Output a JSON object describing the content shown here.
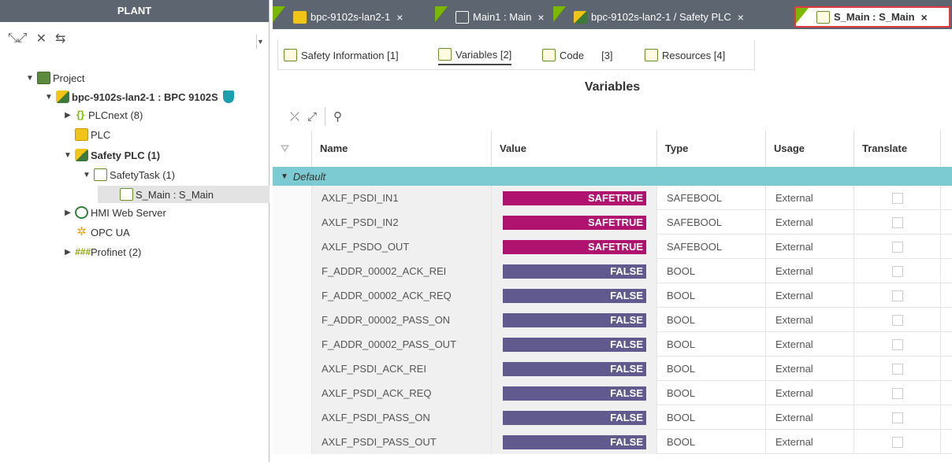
{
  "left_panel": {
    "title": "PLANT",
    "tree": [
      {
        "label": "Project",
        "bold": false
      },
      {
        "label": "bpc-9102s-lan2-1 : BPC 9102S",
        "bold": true
      },
      {
        "label": "PLCnext (8)",
        "bold": false
      },
      {
        "label": "PLC",
        "bold": false
      },
      {
        "label": "Safety PLC (1)",
        "bold": true
      },
      {
        "label": "SafetyTask (1)",
        "bold": false
      },
      {
        "label": "S_Main : S_Main",
        "bold": false
      },
      {
        "label": "HMI Web Server",
        "bold": false
      },
      {
        "label": "OPC UA",
        "bold": false
      },
      {
        "label": "Profinet (2)",
        "bold": false
      }
    ]
  },
  "tabs": [
    {
      "label": "bpc-9102s-lan2-1",
      "close": "×"
    },
    {
      "label": "Main1 : Main",
      "close": "×"
    },
    {
      "label": "bpc-9102s-lan2-1 / Safety PLC",
      "close": "×"
    },
    {
      "label": "S_Main : S_Main",
      "close": "×"
    }
  ],
  "subtabs": [
    {
      "label": "Safety Information [1]"
    },
    {
      "label": "Variables [2]"
    },
    {
      "label": "Code",
      "suffix": "[3]"
    },
    {
      "label": "Resources [4]"
    }
  ],
  "section_title": "Variables",
  "columns": [
    "Name",
    "Value",
    "Type",
    "Usage",
    "Translate"
  ],
  "group": "Default",
  "rows": [
    {
      "name": "AXLF_PSDI_IN1",
      "value": "SAFETRUE",
      "type": "SAFEBOOL",
      "usage": "External",
      "flag": true
    },
    {
      "name": "AXLF_PSDI_IN2",
      "value": "SAFETRUE",
      "type": "SAFEBOOL",
      "usage": "External",
      "flag": true
    },
    {
      "name": "AXLF_PSDO_OUT",
      "value": "SAFETRUE",
      "type": "SAFEBOOL",
      "usage": "External",
      "flag": true
    },
    {
      "name": "F_ADDR_00002_ACK_REI",
      "value": "FALSE",
      "type": "BOOL",
      "usage": "External",
      "flag": false
    },
    {
      "name": "F_ADDR_00002_ACK_REQ",
      "value": "FALSE",
      "type": "BOOL",
      "usage": "External",
      "flag": false
    },
    {
      "name": "F_ADDR_00002_PASS_ON",
      "value": "FALSE",
      "type": "BOOL",
      "usage": "External",
      "flag": false
    },
    {
      "name": "F_ADDR_00002_PASS_OUT",
      "value": "FALSE",
      "type": "BOOL",
      "usage": "External",
      "flag": false
    },
    {
      "name": "AXLF_PSDI_ACK_REI",
      "value": "FALSE",
      "type": "BOOL",
      "usage": "External",
      "flag": false
    },
    {
      "name": "AXLF_PSDI_ACK_REQ",
      "value": "FALSE",
      "type": "BOOL",
      "usage": "External",
      "flag": false
    },
    {
      "name": "AXLF_PSDI_PASS_ON",
      "value": "FALSE",
      "type": "BOOL",
      "usage": "External",
      "flag": false
    },
    {
      "name": "AXLF_PSDI_PASS_OUT",
      "value": "FALSE",
      "type": "BOOL",
      "usage": "External",
      "flag": false
    }
  ],
  "colors": {
    "header_bg": "#5d6570",
    "accent_green": "#7ab800",
    "group_bg": "#7ccbd3",
    "safetrue": "#b0136f",
    "false": "#615a8f",
    "active_tab_border": "#e0393e"
  }
}
